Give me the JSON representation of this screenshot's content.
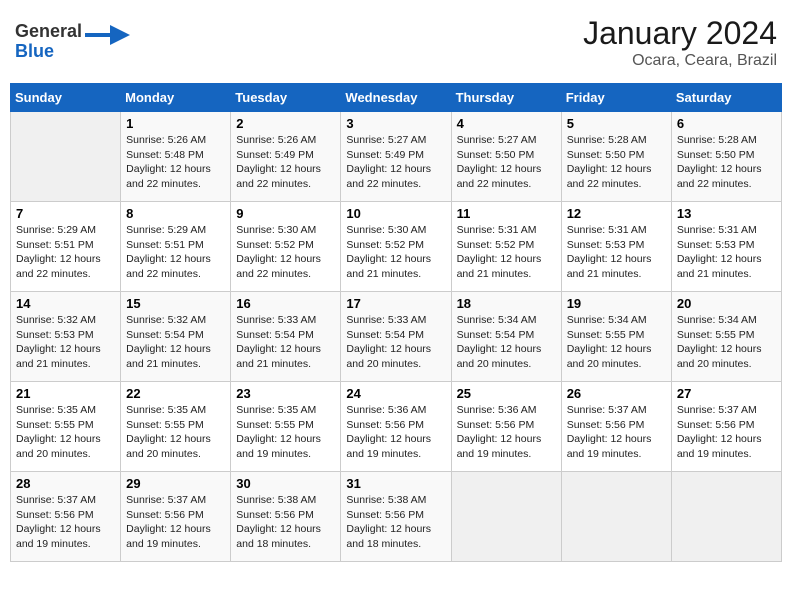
{
  "logo": {
    "line1": "General",
    "line2": "Blue"
  },
  "title": "January 2024",
  "location": "Ocara, Ceara, Brazil",
  "days_of_week": [
    "Sunday",
    "Monday",
    "Tuesday",
    "Wednesday",
    "Thursday",
    "Friday",
    "Saturday"
  ],
  "weeks": [
    [
      {
        "day": "",
        "sunrise": "",
        "sunset": "",
        "daylight": ""
      },
      {
        "day": "1",
        "sunrise": "Sunrise: 5:26 AM",
        "sunset": "Sunset: 5:48 PM",
        "daylight": "Daylight: 12 hours and 22 minutes."
      },
      {
        "day": "2",
        "sunrise": "Sunrise: 5:26 AM",
        "sunset": "Sunset: 5:49 PM",
        "daylight": "Daylight: 12 hours and 22 minutes."
      },
      {
        "day": "3",
        "sunrise": "Sunrise: 5:27 AM",
        "sunset": "Sunset: 5:49 PM",
        "daylight": "Daylight: 12 hours and 22 minutes."
      },
      {
        "day": "4",
        "sunrise": "Sunrise: 5:27 AM",
        "sunset": "Sunset: 5:50 PM",
        "daylight": "Daylight: 12 hours and 22 minutes."
      },
      {
        "day": "5",
        "sunrise": "Sunrise: 5:28 AM",
        "sunset": "Sunset: 5:50 PM",
        "daylight": "Daylight: 12 hours and 22 minutes."
      },
      {
        "day": "6",
        "sunrise": "Sunrise: 5:28 AM",
        "sunset": "Sunset: 5:50 PM",
        "daylight": "Daylight: 12 hours and 22 minutes."
      }
    ],
    [
      {
        "day": "7",
        "sunrise": "Sunrise: 5:29 AM",
        "sunset": "Sunset: 5:51 PM",
        "daylight": "Daylight: 12 hours and 22 minutes."
      },
      {
        "day": "8",
        "sunrise": "Sunrise: 5:29 AM",
        "sunset": "Sunset: 5:51 PM",
        "daylight": "Daylight: 12 hours and 22 minutes."
      },
      {
        "day": "9",
        "sunrise": "Sunrise: 5:30 AM",
        "sunset": "Sunset: 5:52 PM",
        "daylight": "Daylight: 12 hours and 22 minutes."
      },
      {
        "day": "10",
        "sunrise": "Sunrise: 5:30 AM",
        "sunset": "Sunset: 5:52 PM",
        "daylight": "Daylight: 12 hours and 21 minutes."
      },
      {
        "day": "11",
        "sunrise": "Sunrise: 5:31 AM",
        "sunset": "Sunset: 5:52 PM",
        "daylight": "Daylight: 12 hours and 21 minutes."
      },
      {
        "day": "12",
        "sunrise": "Sunrise: 5:31 AM",
        "sunset": "Sunset: 5:53 PM",
        "daylight": "Daylight: 12 hours and 21 minutes."
      },
      {
        "day": "13",
        "sunrise": "Sunrise: 5:31 AM",
        "sunset": "Sunset: 5:53 PM",
        "daylight": "Daylight: 12 hours and 21 minutes."
      }
    ],
    [
      {
        "day": "14",
        "sunrise": "Sunrise: 5:32 AM",
        "sunset": "Sunset: 5:53 PM",
        "daylight": "Daylight: 12 hours and 21 minutes."
      },
      {
        "day": "15",
        "sunrise": "Sunrise: 5:32 AM",
        "sunset": "Sunset: 5:54 PM",
        "daylight": "Daylight: 12 hours and 21 minutes."
      },
      {
        "day": "16",
        "sunrise": "Sunrise: 5:33 AM",
        "sunset": "Sunset: 5:54 PM",
        "daylight": "Daylight: 12 hours and 21 minutes."
      },
      {
        "day": "17",
        "sunrise": "Sunrise: 5:33 AM",
        "sunset": "Sunset: 5:54 PM",
        "daylight": "Daylight: 12 hours and 20 minutes."
      },
      {
        "day": "18",
        "sunrise": "Sunrise: 5:34 AM",
        "sunset": "Sunset: 5:54 PM",
        "daylight": "Daylight: 12 hours and 20 minutes."
      },
      {
        "day": "19",
        "sunrise": "Sunrise: 5:34 AM",
        "sunset": "Sunset: 5:55 PM",
        "daylight": "Daylight: 12 hours and 20 minutes."
      },
      {
        "day": "20",
        "sunrise": "Sunrise: 5:34 AM",
        "sunset": "Sunset: 5:55 PM",
        "daylight": "Daylight: 12 hours and 20 minutes."
      }
    ],
    [
      {
        "day": "21",
        "sunrise": "Sunrise: 5:35 AM",
        "sunset": "Sunset: 5:55 PM",
        "daylight": "Daylight: 12 hours and 20 minutes."
      },
      {
        "day": "22",
        "sunrise": "Sunrise: 5:35 AM",
        "sunset": "Sunset: 5:55 PM",
        "daylight": "Daylight: 12 hours and 20 minutes."
      },
      {
        "day": "23",
        "sunrise": "Sunrise: 5:35 AM",
        "sunset": "Sunset: 5:55 PM",
        "daylight": "Daylight: 12 hours and 19 minutes."
      },
      {
        "day": "24",
        "sunrise": "Sunrise: 5:36 AM",
        "sunset": "Sunset: 5:56 PM",
        "daylight": "Daylight: 12 hours and 19 minutes."
      },
      {
        "day": "25",
        "sunrise": "Sunrise: 5:36 AM",
        "sunset": "Sunset: 5:56 PM",
        "daylight": "Daylight: 12 hours and 19 minutes."
      },
      {
        "day": "26",
        "sunrise": "Sunrise: 5:37 AM",
        "sunset": "Sunset: 5:56 PM",
        "daylight": "Daylight: 12 hours and 19 minutes."
      },
      {
        "day": "27",
        "sunrise": "Sunrise: 5:37 AM",
        "sunset": "Sunset: 5:56 PM",
        "daylight": "Daylight: 12 hours and 19 minutes."
      }
    ],
    [
      {
        "day": "28",
        "sunrise": "Sunrise: 5:37 AM",
        "sunset": "Sunset: 5:56 PM",
        "daylight": "Daylight: 12 hours and 19 minutes."
      },
      {
        "day": "29",
        "sunrise": "Sunrise: 5:37 AM",
        "sunset": "Sunset: 5:56 PM",
        "daylight": "Daylight: 12 hours and 19 minutes."
      },
      {
        "day": "30",
        "sunrise": "Sunrise: 5:38 AM",
        "sunset": "Sunset: 5:56 PM",
        "daylight": "Daylight: 12 hours and 18 minutes."
      },
      {
        "day": "31",
        "sunrise": "Sunrise: 5:38 AM",
        "sunset": "Sunset: 5:56 PM",
        "daylight": "Daylight: 12 hours and 18 minutes."
      },
      {
        "day": "",
        "sunrise": "",
        "sunset": "",
        "daylight": ""
      },
      {
        "day": "",
        "sunrise": "",
        "sunset": "",
        "daylight": ""
      },
      {
        "day": "",
        "sunrise": "",
        "sunset": "",
        "daylight": ""
      }
    ]
  ]
}
